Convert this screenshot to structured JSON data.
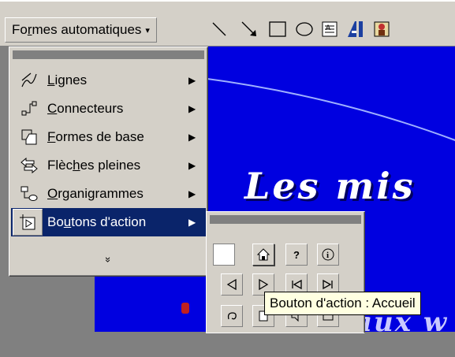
{
  "toolbar": {
    "autoshapes_label": "Formes automatiques",
    "autoshapes_arrow": "▾",
    "tools": [
      "line-icon",
      "arrow-icon",
      "rectangle-icon",
      "oval-icon",
      "text-box-icon",
      "wordart-icon",
      "clipart-icon"
    ]
  },
  "menu": {
    "items": [
      {
        "label": "Lignes",
        "icon": "lines-icon",
        "mnemonic_index": 0
      },
      {
        "label": "Connecteurs",
        "icon": "connectors-icon",
        "mnemonic_index": 0
      },
      {
        "label": "Formes de base",
        "icon": "basic-shapes-icon",
        "mnemonic_index": 0
      },
      {
        "label": "Flèches pleines",
        "icon": "block-arrows-icon",
        "mnemonic_index": 4
      },
      {
        "label": "Organigrammes",
        "icon": "flowchart-icon",
        "mnemonic_index": 0
      },
      {
        "label": "Boutons d'action",
        "icon": "action-buttons-icon",
        "mnemonic_index": 2,
        "active": true
      }
    ],
    "expand": "»"
  },
  "palette": {
    "buttons": [
      "blank",
      "home",
      "help",
      "information",
      "back",
      "forward",
      "beginning",
      "end",
      "return",
      "document",
      "sound",
      "movie"
    ]
  },
  "tooltip": {
    "text": "Bouton d'action : Accueil"
  },
  "slide": {
    "title_line1": "Les mis",
    "title_line2": "aux w"
  },
  "colors": {
    "slide_background": "#0000e0",
    "menu_highlight": "#0a246a",
    "chrome": "#d4d0c8",
    "tooltip": "#ffffe1"
  }
}
